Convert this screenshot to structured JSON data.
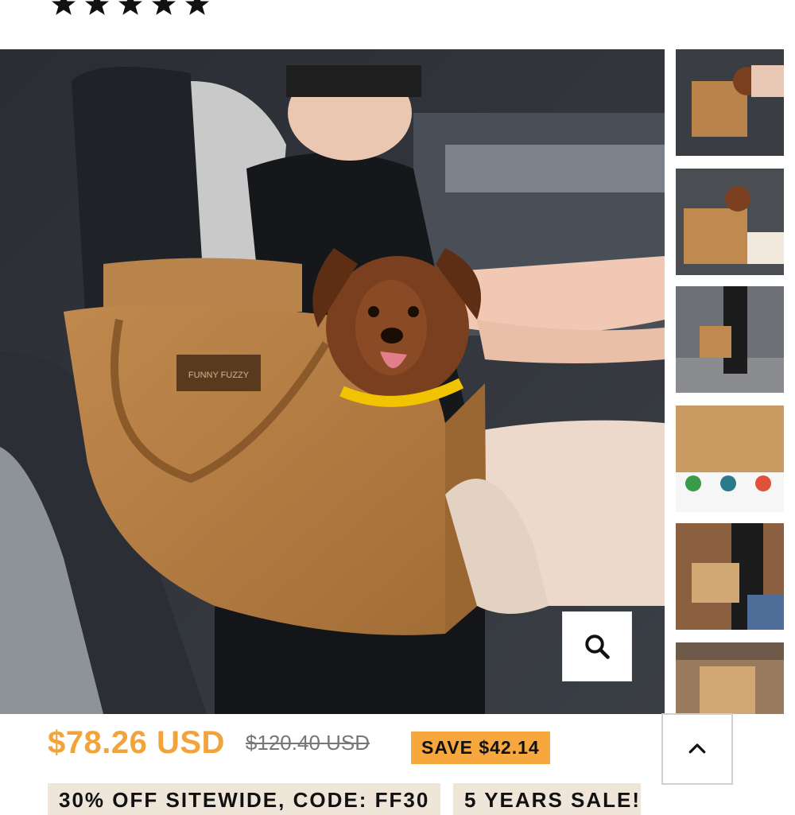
{
  "rating": {
    "stars": 5,
    "icon": "star-icon"
  },
  "gallery": {
    "main_image_alt": "Dachshund in brown car seat carrier",
    "thumbnails": [
      {
        "id": 1
      },
      {
        "id": 2
      },
      {
        "id": 3
      },
      {
        "id": 4
      },
      {
        "id": 5
      },
      {
        "id": 6
      }
    ],
    "zoom_icon": "search-icon"
  },
  "product": {
    "brand_tag": "FUNNY FUZZY",
    "price": "$78.26 USD",
    "compare_price": "$120.40 USD",
    "save_label": "SAVE $42.14"
  },
  "promos": {
    "banner_1": "30% OFF SITEWIDE, CODE: FF30",
    "banner_2": "5 YEARS SALE!"
  },
  "colors": {
    "accent": "#f2a33a",
    "badge": "#f6a73d",
    "promo_bg": "#efe6d9"
  }
}
